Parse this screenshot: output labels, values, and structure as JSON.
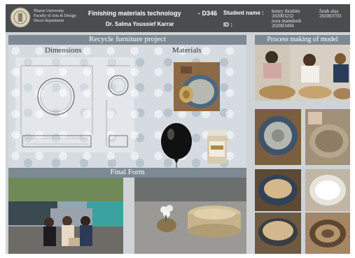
{
  "header": {
    "university": [
      "Pharos University",
      "Faculty of Arts & Design",
      "Decor department"
    ],
    "course_title": "Finishing materials technology",
    "course_code": "- D346",
    "instructor": "Dr. Salma Youssief Karrar",
    "student_name_label": "Student name :",
    "id_label": "ID :",
    "students": [
      {
        "name": "kenzy ibrahim",
        "id": "202003232"
      },
      {
        "name": "nora mamdouh",
        "id": "202003494"
      },
      {
        "name": "farah alaa",
        "id": "202003703"
      }
    ]
  },
  "sections": {
    "project_title": "Recycle furniture project",
    "dimensions": "Dimensions",
    "materials": "Materials",
    "final_form": "Final Form",
    "process": "Process making of model"
  },
  "colors": {
    "header_bg": "#4a4c4e",
    "band_bg": "#7d8a94",
    "board_bg": "#cfd3d6"
  }
}
